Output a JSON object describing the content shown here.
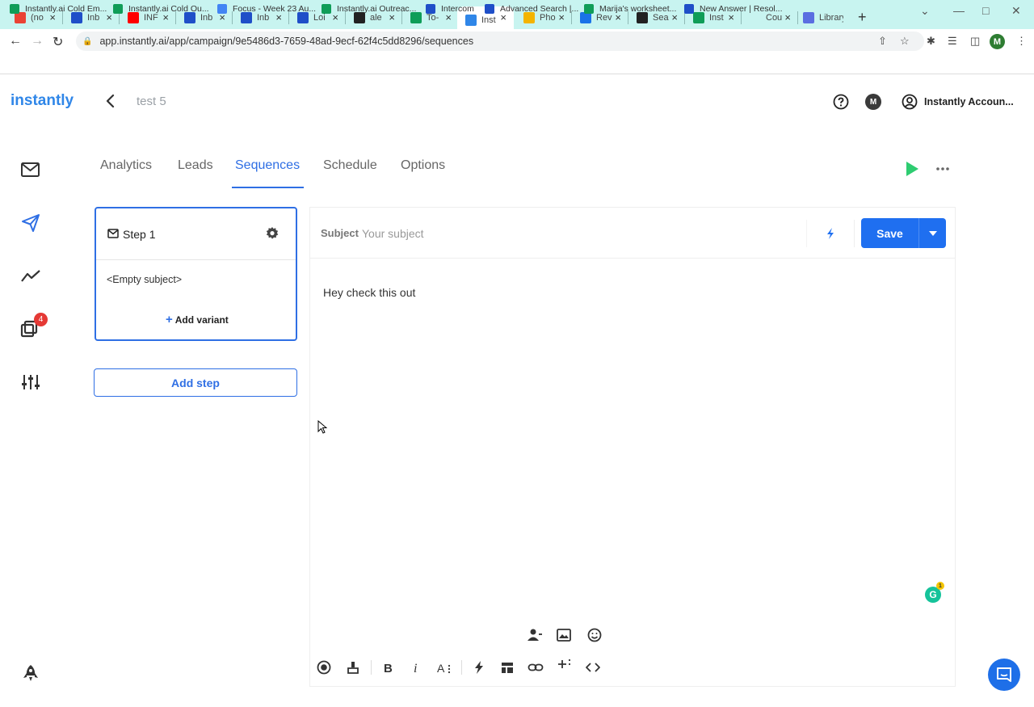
{
  "browser": {
    "tabs": [
      {
        "title": "(no",
        "icon": "gmail-icon",
        "color": "#ea4335"
      },
      {
        "title": "Inb",
        "icon": "intercom-icon",
        "color": "#1f4fc8"
      },
      {
        "title": "INF",
        "icon": "youtube-icon",
        "color": "#ff0000"
      },
      {
        "title": "Inb",
        "icon": "intercom-icon",
        "color": "#1f4fc8"
      },
      {
        "title": "Inb",
        "icon": "intercom-icon",
        "color": "#1f4fc8"
      },
      {
        "title": "Loi",
        "icon": "intercom-icon",
        "color": "#1f4fc8"
      },
      {
        "title": "ale",
        "icon": "medium-icon",
        "color": "#222222"
      },
      {
        "title": "To-",
        "icon": "sheets-icon",
        "color": "#0f9d58"
      },
      {
        "title": "Inst",
        "icon": "instantly-icon",
        "color": "#2f86e8",
        "active": true
      },
      {
        "title": "Pho",
        "icon": "photos-icon",
        "color": "#f4b400"
      },
      {
        "title": "Rev",
        "icon": "search-icon",
        "color": "#1a73e8"
      },
      {
        "title": "Sea",
        "icon": "document-icon",
        "color": "#222222"
      },
      {
        "title": "Inst",
        "icon": "sheets-icon",
        "color": "#0f9d58"
      },
      {
        "title": "Cou",
        "icon": "blank-icon",
        "color": "#c8f4f0"
      },
      {
        "title": "Library",
        "icon": "library-icon",
        "color": "#5b6ee1"
      }
    ],
    "url": "app.instantly.ai/app/campaign/9e5486d3-7659-48ad-9ecf-62f4c5dd8296/sequences",
    "profile_initial": "M",
    "bookmarks": [
      {
        "label": "Instantly.ai Cold Em...",
        "color": "#0f9d58"
      },
      {
        "label": "Instantly.ai Cold Ou...",
        "color": "#0f9d58"
      },
      {
        "label": "Focus - Week 23 Au...",
        "color": "#4285f4"
      },
      {
        "label": "Instantly.ai Outreac...",
        "color": "#0f9d58"
      },
      {
        "label": "Intercom",
        "color": "#1f4fc8"
      },
      {
        "label": "Advanced Search |...",
        "color": "#1f4fc8"
      },
      {
        "label": "Marija's worksheet...",
        "color": "#0f9d58"
      },
      {
        "label": "New Answer | Resol...",
        "color": "#1f4fc8"
      }
    ]
  },
  "app": {
    "logo": "instantly",
    "campaign_name": "test 5",
    "account_name": "Instantly Accoun...",
    "avatar_initial": "M",
    "accent": "#2f6fe4",
    "nav_tabs": [
      {
        "label": "Analytics",
        "name": "tab-analytics"
      },
      {
        "label": "Leads",
        "name": "tab-leads"
      },
      {
        "label": "Sequences",
        "name": "tab-sequences",
        "active": true
      },
      {
        "label": "Schedule",
        "name": "tab-schedule"
      },
      {
        "label": "Options",
        "name": "tab-options"
      }
    ],
    "sidebar_badge": "4",
    "step": {
      "title": "Step 1",
      "subject": "<Empty subject>",
      "add_variant": "Add variant"
    },
    "add_step": "Add step",
    "editor": {
      "subject_label": "Subject",
      "subject_placeholder": "Your subject",
      "save_label": "Save",
      "body": "Hey check this out",
      "grammarly_badge": "1"
    }
  }
}
